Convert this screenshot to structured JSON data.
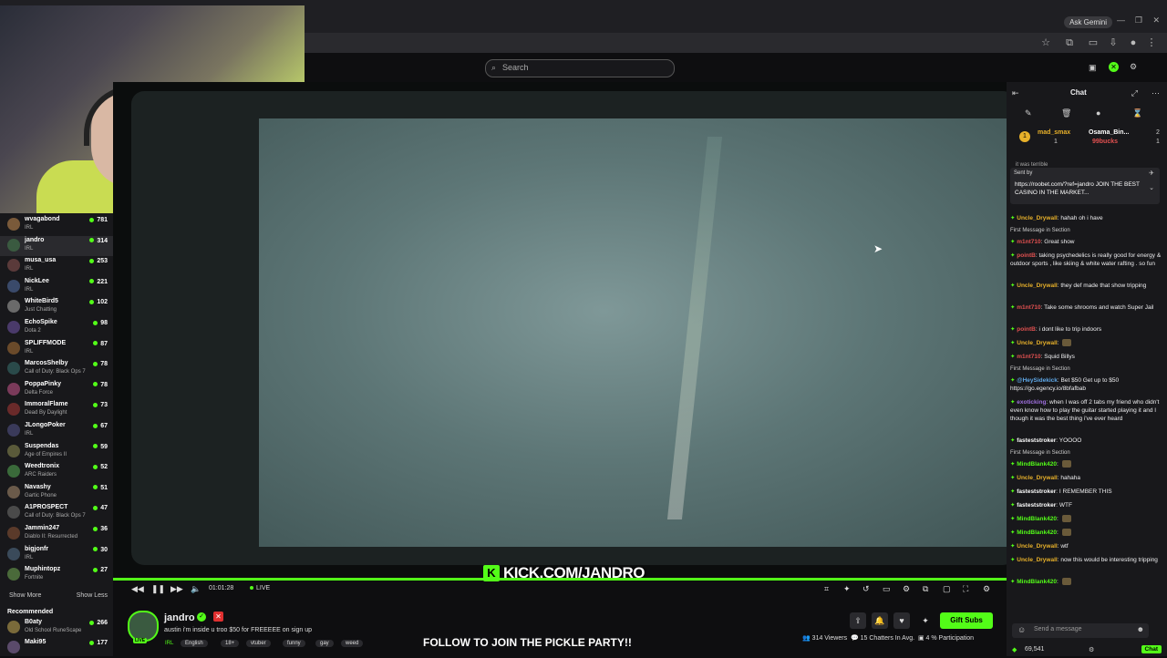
{
  "browser": {
    "ask_gemini": "Ask Gemini"
  },
  "site": {
    "search_placeholder": "Search"
  },
  "sidebar": {
    "channels": [
      {
        "name": "wvagabond",
        "category": "IRL",
        "viewers": "781",
        "color": "#7a5a3a"
      },
      {
        "name": "jandro",
        "category": "IRL",
        "viewers": "314",
        "color": "#3a5a40"
      },
      {
        "name": "musa_usa",
        "category": "IRL",
        "viewers": "253",
        "color": "#5a3a3a"
      },
      {
        "name": "NickLee",
        "category": "IRL",
        "viewers": "221",
        "color": "#3a4a6a"
      },
      {
        "name": "WhiteBird5",
        "category": "Just Chatting",
        "viewers": "102",
        "color": "#6a6a6a"
      },
      {
        "name": "EchoSpike",
        "category": "Dota 2",
        "viewers": "98",
        "color": "#4a3a6a"
      },
      {
        "name": "SPLIFFMODE",
        "category": "IRL",
        "viewers": "87",
        "color": "#6a4a2a"
      },
      {
        "name": "MarcosShelby",
        "category": "Call of Duty: Black Ops 7",
        "viewers": "78",
        "color": "#2a4a4a"
      },
      {
        "name": "PoppaPinky",
        "category": "Delta Force",
        "viewers": "78",
        "color": "#7a3a5a"
      },
      {
        "name": "ImmoralFlame",
        "category": "Dead By Daylight",
        "viewers": "73",
        "color": "#6a2a2a"
      },
      {
        "name": "JLongoPoker",
        "category": "IRL",
        "viewers": "67",
        "color": "#3a3a5a"
      },
      {
        "name": "Suspendas",
        "category": "Age of Empires II",
        "viewers": "59",
        "color": "#5a5a3a"
      },
      {
        "name": "Weedtronix",
        "category": "ARC Raiders",
        "viewers": "52",
        "color": "#3a6a3a"
      },
      {
        "name": "Navashy",
        "category": "Gartic Phone",
        "viewers": "51",
        "color": "#6a5a4a"
      },
      {
        "name": "A1PROSPECT",
        "category": "Call of Duty: Black Ops 7",
        "viewers": "47",
        "color": "#4a4a4a"
      },
      {
        "name": "Jammin247",
        "category": "Diablo II: Resurrected",
        "viewers": "36",
        "color": "#5a3a2a"
      },
      {
        "name": "bigjonfr",
        "category": "IRL",
        "viewers": "30",
        "color": "#3a4a5a"
      },
      {
        "name": "Muphintopz",
        "category": "Fortnite",
        "viewers": "27",
        "color": "#4a6a3a"
      }
    ],
    "show_more": "Show More",
    "show_less": "Show Less",
    "recommended_label": "Recommended",
    "recommended": [
      {
        "name": "B0aty",
        "category": "Old School RuneScape",
        "viewers": "266",
        "color": "#7a6a3a"
      },
      {
        "name": "Maki95",
        "category": "",
        "viewers": "177",
        "color": "#5a4a6a"
      }
    ]
  },
  "player": {
    "banner": "KICK.COM/JANDRO",
    "time": "01:01:28",
    "live": "LIVE"
  },
  "stream": {
    "streamer": "jandro",
    "live_tag": "LIVE",
    "title": "austin i'm inside u troo $50 for FREEEEE on sign up",
    "category": "IRL",
    "tags": [
      "English",
      "18+",
      "vtuber",
      "funny",
      "gay",
      "weed"
    ],
    "overlay": "FOLLOW TO JOIN THE PICKLE PARTY!!",
    "gift_subs": "Gift Subs",
    "viewers": "314 Viewers",
    "chatters": "15 Chatters In Avg.",
    "participation": "4 % Participation"
  },
  "chat": {
    "title": "Chat",
    "gifters": [
      {
        "name": "mad_smax",
        "amount": "1"
      },
      {
        "name": "Osama_Bin...",
        "amount": "2"
      },
      {
        "name": "99bucks",
        "amount": "1"
      }
    ],
    "pinned_sender": "Sent by",
    "pinned_text": "https://roobet.com/?ref=jandro JOIN THE BEST CASINO IN THE MARKET...",
    "above_pinned": "it was terrible",
    "messages": [
      {
        "user": "Uncle_Drywall",
        "text": "hahah oh i have",
        "color": "#e8b12a"
      },
      {
        "section": "First Message in Section"
      },
      {
        "user": "m1nt710",
        "text": "Great show",
        "color": "#e05050"
      },
      {
        "user": "pointB",
        "text": "taking psychedelics is really good for energy & outdoor sports , like skiing & white water rafting . so fun",
        "color": "#e05050"
      },
      {
        "user": "Uncle_Drywall",
        "text": "they def made that show tripping",
        "color": "#e8b12a"
      },
      {
        "user": "m1nt710",
        "text": "Take some shrooms and watch Super Jail",
        "color": "#e05050"
      },
      {
        "user": "pointB",
        "text": "i dont like to trip indoors",
        "color": "#e05050"
      },
      {
        "user": "Uncle_Drywall",
        "text": "",
        "color": "#e8b12a"
      },
      {
        "user": "m1nt710",
        "text": "Squid Billys",
        "color": "#e05050"
      },
      {
        "section": "First Message in Section"
      },
      {
        "user": "@HeySidekick",
        "text": "Bet $50 Get up to $50 https://go.egency.io/8bfafbab",
        "color": "#5fa8e8"
      },
      {
        "user": "exoticking",
        "text": "when I was off 2 tabs my friend who didn't even know how to play the guitar started playing it and I though it was the best thing i've ever heard",
        "color": "#a070e0"
      },
      {
        "user": "fasteststroker",
        "text": "YOOOO",
        "color": "#ffffff"
      },
      {
        "section": "First Message in Section"
      },
      {
        "user": "MindBlank420",
        "text": "",
        "color": "#53fc18"
      },
      {
        "user": "Uncle_Drywall",
        "text": "hahaha",
        "color": "#e8b12a"
      },
      {
        "user": "fasteststroker",
        "text": "I REMEMBER THIS",
        "color": "#ffffff"
      },
      {
        "user": "fasteststroker",
        "text": "WTF",
        "color": "#ffffff"
      },
      {
        "user": "MindBlank420",
        "text": "",
        "color": "#53fc18"
      },
      {
        "user": "MindBlank420",
        "text": "",
        "color": "#53fc18"
      },
      {
        "user": "Uncle_Drywall",
        "text": "wtf",
        "color": "#e8b12a"
      },
      {
        "user": "Uncle_Drywall",
        "text": "now this would be interesting tripping",
        "color": "#e8b12a"
      },
      {
        "user": "MindBlank420",
        "text": "",
        "color": "#53fc18"
      }
    ],
    "input_placeholder": "Send a message",
    "points": "69,541",
    "chat_button": "Chat"
  }
}
